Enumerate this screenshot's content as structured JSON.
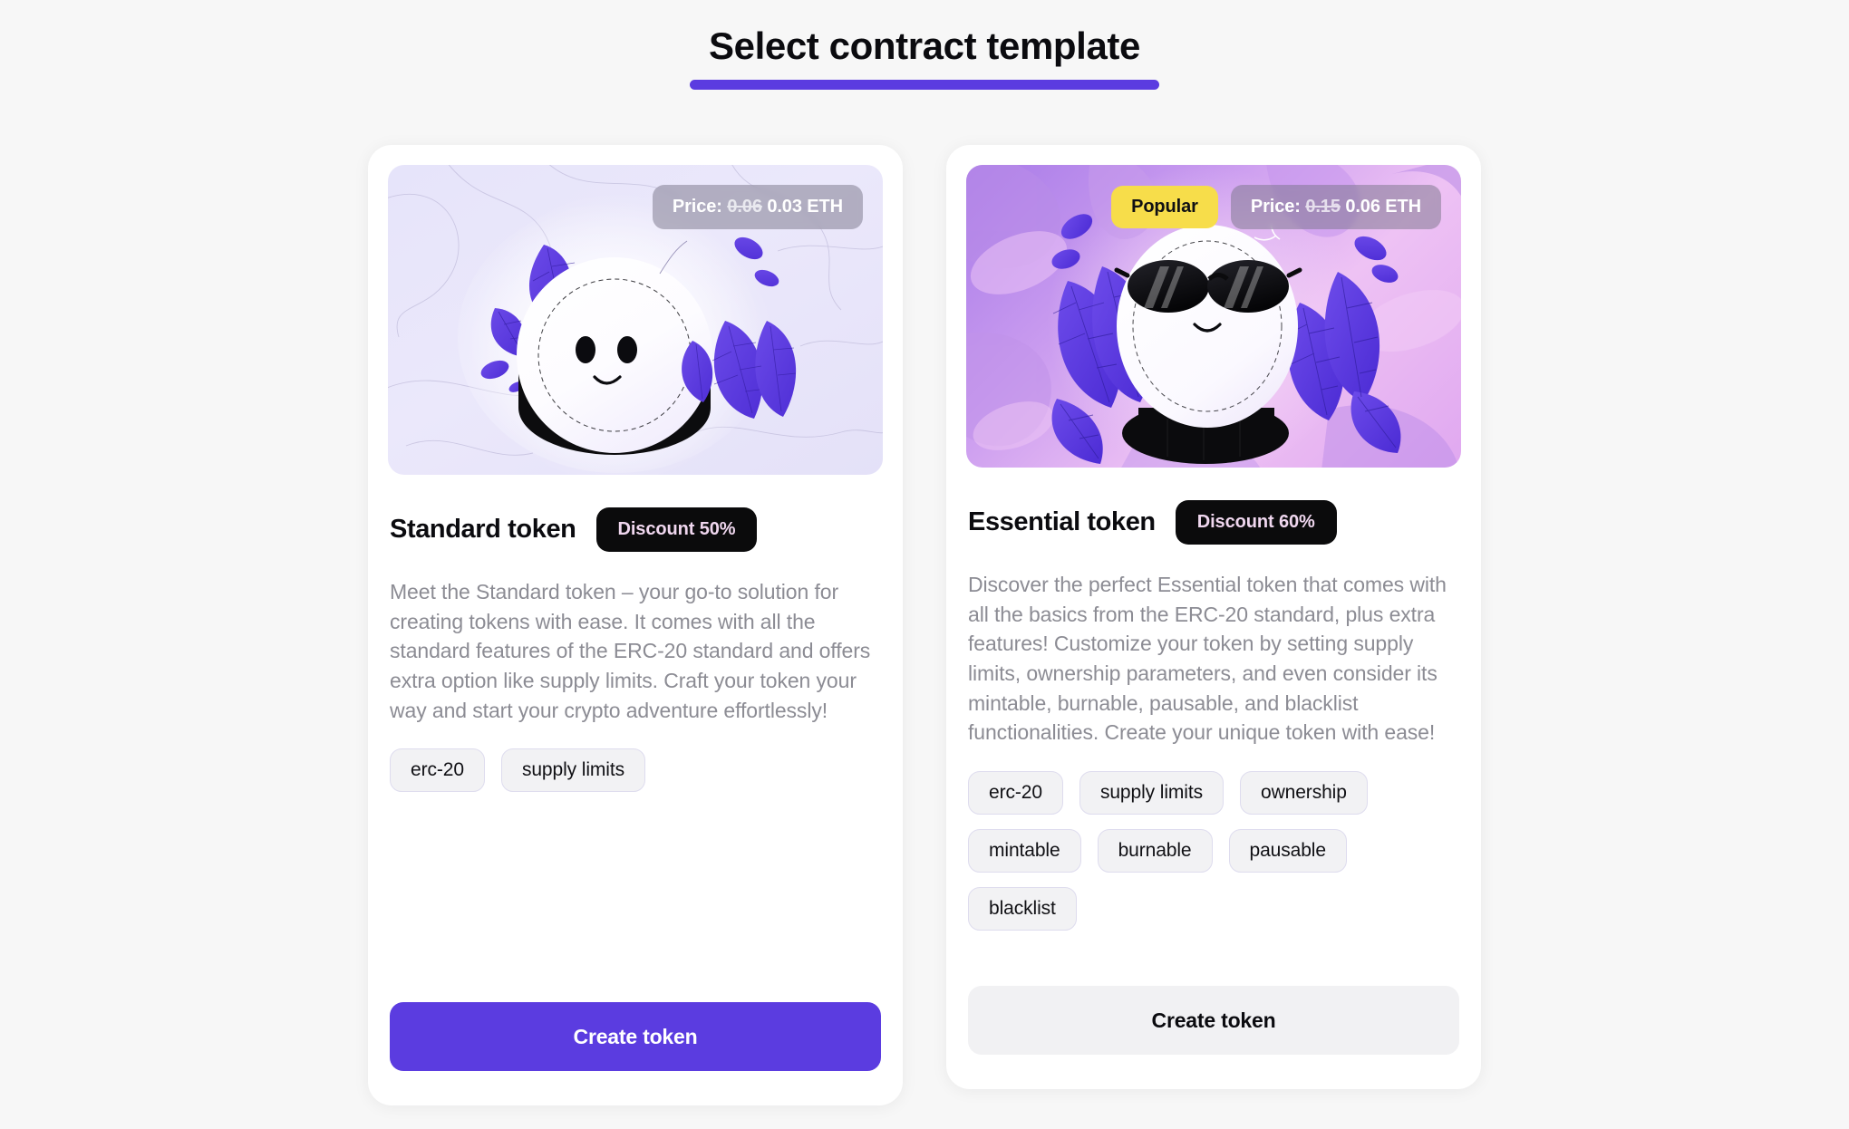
{
  "header": {
    "title": "Select contract template"
  },
  "cards": [
    {
      "id": "standard",
      "hero_icon": "coin-smiley-icon",
      "price": {
        "label": "Price:",
        "old": "0.06",
        "new": "0.03 ETH"
      },
      "title": "Standard token",
      "discount": "Discount 50%",
      "description": "Meet the Standard token – your go-to solution for creating tokens with ease. It comes with all the standard features of the ERC-20 standard and offers extra option like supply limits. Craft your token your way and start your crypto adventure effortlessly!",
      "tags": [
        "erc-20",
        "supply limits"
      ],
      "cta": "Create token"
    },
    {
      "id": "essential",
      "hero_icon": "coin-sunglasses-icon",
      "popular": "Popular",
      "price": {
        "label": "Price:",
        "old": "0.15",
        "new": "0.06 ETH"
      },
      "title": "Essential token",
      "discount": "Discount 60%",
      "description": "Discover the perfect Essential token that comes with all the basics from the ERC-20 standard, plus extra features! Customize your token by setting supply limits, ownership parameters, and even consider its mintable, burnable, pausable, and blacklist functionalities. Create your unique token with ease!",
      "tags": [
        "erc-20",
        "supply limits",
        "ownership",
        "mintable",
        "burnable",
        "pausable",
        "blacklist"
      ],
      "cta": "Create token"
    }
  ],
  "colors": {
    "accent": "#5b3ce0",
    "page_bg": "#f7f7f7",
    "card_bg": "#ffffff",
    "popular_badge": "#f7dd4a",
    "discount_badge_bg": "#0b0b0c",
    "discount_badge_text": "#f0d7ef",
    "muted_text": "#8c8c94",
    "leaf_purple": "#5b3ce0"
  }
}
